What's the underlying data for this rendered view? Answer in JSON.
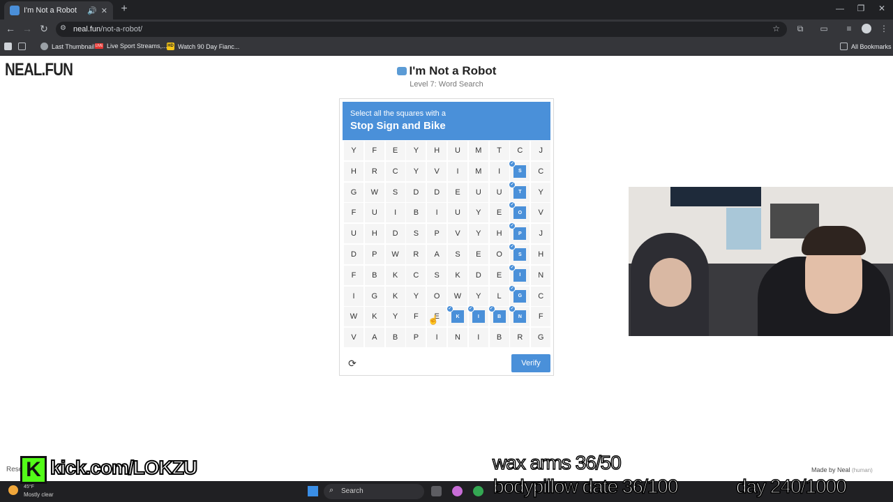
{
  "browser": {
    "tab_title": "I'm Not a Robot",
    "new_tab": "+",
    "url_host": "neal.fun",
    "url_path": "/not-a-robot/",
    "bookmarks": [
      "Last Thumbnail",
      "Live Sport Streams,...",
      "Watch 90 Day Fianc..."
    ],
    "all_bookmarks": "All Bookmarks",
    "live_badge": "LIVE",
    "hd_badge": "HD"
  },
  "page": {
    "logo": "NEAL.FUN",
    "title": "I'm Not a Robot",
    "level": "Level 7: Word Search",
    "prompt_pre": "Select all the squares with a",
    "prompt_target": "Stop Sign and Bike",
    "verify_label": "Verify",
    "reset_label": "Rese",
    "made_by": "Made by Neal",
    "made_by_note": "(human)"
  },
  "grid": [
    [
      "Y",
      "F",
      "E",
      "Y",
      "H",
      "U",
      "M",
      "T",
      "C",
      "J"
    ],
    [
      "H",
      "R",
      "C",
      "Y",
      "V",
      "I",
      "M",
      "I",
      "S",
      "C"
    ],
    [
      "G",
      "W",
      "S",
      "D",
      "D",
      "E",
      "U",
      "U",
      "T",
      "Y"
    ],
    [
      "F",
      "U",
      "I",
      "B",
      "I",
      "U",
      "Y",
      "E",
      "O",
      "V"
    ],
    [
      "U",
      "H",
      "D",
      "S",
      "P",
      "V",
      "Y",
      "H",
      "P",
      "J"
    ],
    [
      "D",
      "P",
      "W",
      "R",
      "A",
      "S",
      "E",
      "O",
      "S",
      "H"
    ],
    [
      "F",
      "B",
      "K",
      "C",
      "S",
      "K",
      "D",
      "E",
      "I",
      "N"
    ],
    [
      "I",
      "G",
      "K",
      "Y",
      "O",
      "W",
      "Y",
      "L",
      "G",
      "C"
    ],
    [
      "W",
      "K",
      "Y",
      "F",
      "E",
      "K",
      "I",
      "B",
      "N",
      "F"
    ],
    [
      "V",
      "A",
      "B",
      "P",
      "I",
      "N",
      "I",
      "B",
      "R",
      "G"
    ]
  ],
  "selected_cells": [
    [
      1,
      8
    ],
    [
      2,
      8
    ],
    [
      3,
      8
    ],
    [
      4,
      8
    ],
    [
      5,
      8
    ],
    [
      6,
      8
    ],
    [
      7,
      8
    ],
    [
      8,
      5
    ],
    [
      8,
      6
    ],
    [
      8,
      7
    ],
    [
      8,
      8
    ]
  ],
  "taskbar": {
    "temperature": "45°F",
    "weather": "Mostly clear",
    "search_placeholder": "Search"
  },
  "stream_overlay": {
    "kick_letter": "K",
    "kick_url": "kick.com/LOKZU",
    "line1": "wax arms 36/50",
    "line2": "bodypillow date 36/100",
    "line3": "day 240/1000"
  },
  "colors": {
    "accent": "#4a90d9",
    "kick_green": "#53fc18"
  }
}
